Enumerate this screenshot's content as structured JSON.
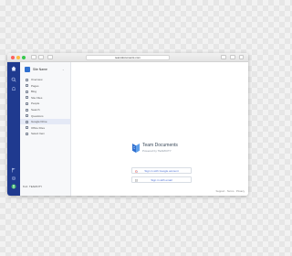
{
  "browser": {
    "url": "teamdocuments.com"
  },
  "rail": {
    "icons": [
      "home-icon",
      "search-icon",
      "bell-icon",
      "flag-icon",
      "settings-icon",
      "user-icon"
    ],
    "colors": {
      "rail": "#1f3a8f",
      "accent": "#2f6fcf"
    }
  },
  "nav": {
    "site_name": "Site Name",
    "items": [
      {
        "label": "Overview"
      },
      {
        "label": "Pages"
      },
      {
        "label": "Blog"
      },
      {
        "label": "Site Files"
      },
      {
        "label": "People"
      },
      {
        "label": "Search"
      },
      {
        "label": "Questions"
      },
      {
        "label": "Google Drive"
      },
      {
        "label": "Office Files"
      },
      {
        "label": "Select Item"
      }
    ],
    "active_index": 7,
    "footer_label": "Built",
    "footer_brand": "TEAMCITY"
  },
  "main": {
    "brand_title": "Team Documents",
    "brand_subtitle": "Powered by TEAMCITY",
    "signin_google": "Sign in with Google account",
    "signin_email": "Sign in with email",
    "footer_links": "Support · Terms · Privacy"
  }
}
